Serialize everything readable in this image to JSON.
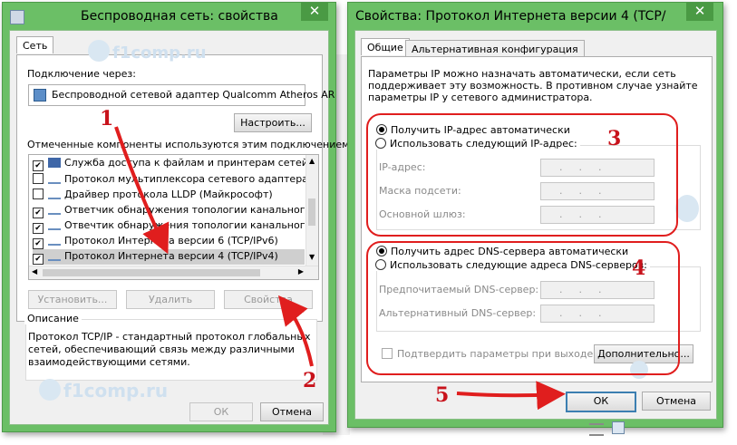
{
  "left_window": {
    "title": "Беспроводная сеть: свойства",
    "close_glyph": "✕",
    "tab": "Сеть",
    "connect_via_label": "Подключение через:",
    "adapter_name": "Беспроводной сетевой адаптер Qualcomm Atheros AR",
    "configure_button": "Настроить...",
    "components_label": "Отмеченные компоненты используются этим подключением:",
    "components": [
      {
        "label": "Служба доступа к файлам и принтерам сетей Micro",
        "checked": true,
        "icon": "network-client-icon"
      },
      {
        "label": "Протокол мультиплексора сетевого адаптера (Ма",
        "checked": false,
        "icon": "protocol-icon"
      },
      {
        "label": "Драйвер протокола LLDP (Майкрософт)",
        "checked": false,
        "icon": "protocol-icon"
      },
      {
        "label": "Ответчик обнаружения топологии канального уров",
        "checked": true,
        "icon": "protocol-icon"
      },
      {
        "label": "Отвечтик обнаружения топологии канального уров",
        "checked": true,
        "icon": "protocol-icon"
      },
      {
        "label": "Протокол Интернета версии 6 (TCP/IPv6)",
        "checked": true,
        "icon": "protocol-icon"
      },
      {
        "label": "Протокол Интернета версии 4 (TCP/IPv4)",
        "checked": true,
        "icon": "protocol-icon",
        "selected": true
      }
    ],
    "install_button": "Установить...",
    "remove_button": "Удалить",
    "properties_button": "Свойства",
    "description_legend": "Описание",
    "description_text": [
      "Протокол TCP/IP - стандартный протокол глобальных",
      "сетей, обеспечивающий связь между различными",
      "взаимодействующими сетями."
    ],
    "ok_button": "ОК",
    "cancel_button": "Отмена"
  },
  "right_window": {
    "title": "Свойства: Протокол Интернета версии 4 (TCP/",
    "close_glyph": "✕",
    "tabs": [
      "Общие",
      "Альтернативная конфигурация"
    ],
    "intro_text": [
      "Параметры IP можно назначать автоматически, если сеть",
      "поддерживает эту возможность. В противном случае узнайте",
      "параметры IP у сетевого администратора."
    ],
    "ip_auto_radio": "Получить IP-адрес автоматически",
    "ip_manual_radio": "Использовать следующий IP-адрес:",
    "ip_address_label": "IP-адрес:",
    "subnet_label": "Маска подсети:",
    "gateway_label": "Основной шлюз:",
    "ip_placeholder": "...",
    "dns_auto_radio": "Получить адрес DNS-сервера автоматически",
    "dns_manual_radio": "Использовать следующие адреса DNS-серверов:",
    "preferred_dns_label": "Предпочитаемый DNS-сервер:",
    "alternate_dns_label": "Альтернативный DNS-сервер:",
    "validate_checkbox": "Подтвердить параметры при выходе",
    "advanced_button": "Дополнительно...",
    "ok_button": "ОК",
    "cancel_button": "Отмена"
  },
  "annotations": {
    "n1": "1",
    "n2": "2",
    "n3": "3",
    "n4": "4",
    "n5": "5",
    "color": "#e01e1e"
  },
  "watermarks": {
    "site": "f1comp.ru"
  }
}
